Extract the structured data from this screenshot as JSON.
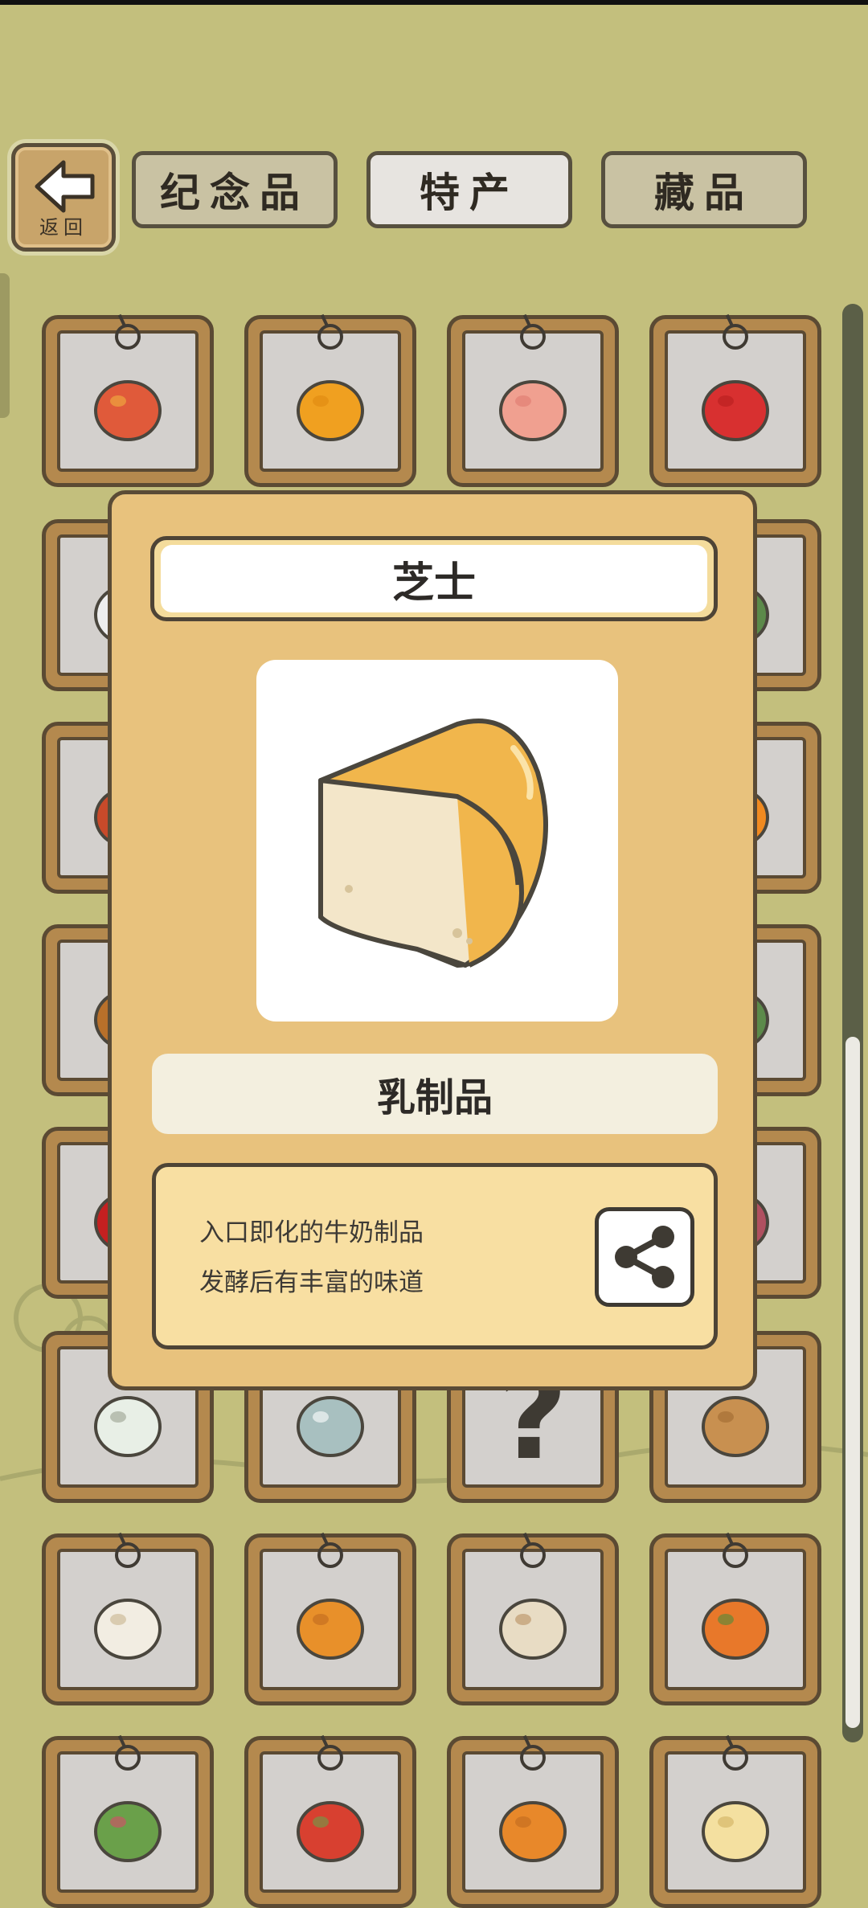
{
  "back": {
    "label": "返回"
  },
  "tabs": [
    {
      "label": "纪念品",
      "active": false
    },
    {
      "label": "特产",
      "active": true
    },
    {
      "label": "藏品",
      "active": false
    }
  ],
  "grid_items": [
    "mango-icon",
    "orange-icon",
    "peach-icon",
    "apple-icon",
    "vase-icon",
    "",
    "",
    "leaf-icon",
    "chili-icon",
    "",
    "",
    "persimmon-icon",
    "curry-icon",
    "",
    "",
    "leaf2-icon",
    "cherry-icon",
    "",
    "",
    "book-icon",
    "rice-bag-icon",
    "teacake-icon",
    "unknown-icon",
    "basket-icon",
    "dumplings-icon",
    "tarts-icon",
    "porridge-icon",
    "carrot-icon",
    "turnip-icon",
    "tomatoes-icon",
    "pumpkins-icon",
    "noodles-icon"
  ],
  "detail": {
    "name": "芝士",
    "category": "乳制品",
    "description_line1": "入口即化的牛奶制品",
    "description_line2": "发酵后有丰富的味道",
    "image_icon": "cheese-icon",
    "share_icon": "share-icon"
  },
  "unknown_glyph": "?"
}
